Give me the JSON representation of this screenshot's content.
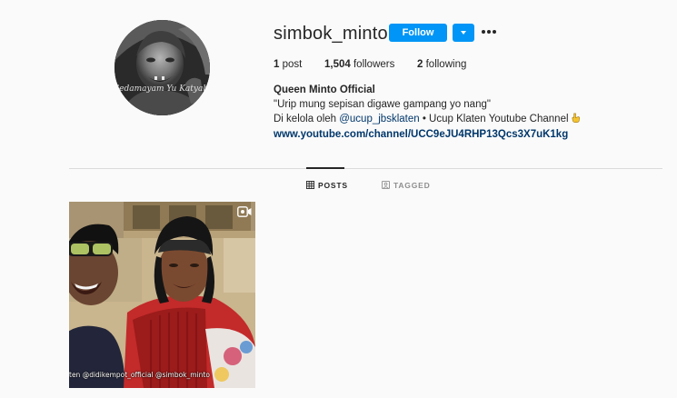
{
  "profile": {
    "username": "simbok_minto",
    "follow_label": "Follow",
    "stats": {
      "posts_count": "1",
      "posts_label": "post",
      "followers_count": "1,504",
      "followers_label": "followers",
      "following_count": "2",
      "following_label": "following"
    },
    "full_name": "Queen Minto Official",
    "bio_line1": "\"Urip mung sepisan digawe gampang yo nang\"",
    "bio_line2_prefix": "Di kelola oleh ",
    "bio_mention": "@ucup_jbsklaten",
    "bio_line2_suffix": " • Ucup Klaten Youtube Channel",
    "website": "www.youtube.com/channel/UCC9eJU4RHP13Qcs3X7uK1kg",
    "avatar_watermark": "Gedamayam Yu Katyahi",
    "avatar_icon": "avatar-photo",
    "bio_emoji_icon": "pointing-down-emoji"
  },
  "tabs": {
    "posts_label": "POSTS",
    "tagged_label": "TAGGED",
    "posts_icon": "grid-icon",
    "tagged_icon": "tag-icon"
  },
  "post": {
    "overlay_text": "ten @didikempot_official @simbok_minto",
    "badge_icon": "video-icon"
  },
  "colors": {
    "follow_button": "#0095f6",
    "link": "#00376b",
    "background": "#fafafa",
    "divider": "#dbdbdb"
  }
}
